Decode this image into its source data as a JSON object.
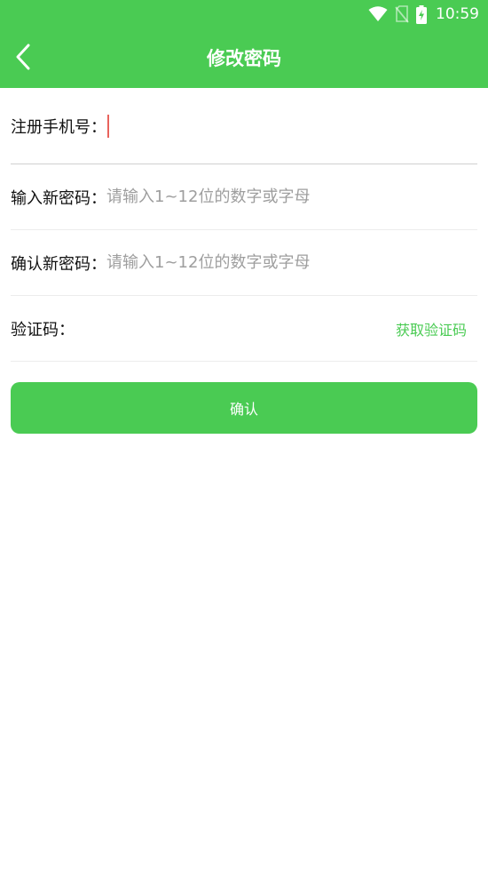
{
  "status_bar": {
    "time": "10:59",
    "icons": [
      "wifi-icon",
      "no-sim-icon",
      "battery-charging-icon"
    ]
  },
  "header": {
    "back_icon": "chevron-left-icon",
    "title": "修改密码"
  },
  "form": {
    "phone": {
      "label": "注册手机号：",
      "value": "",
      "placeholder": ""
    },
    "new_password": {
      "label": "输入新密码：",
      "value": "",
      "placeholder": "请输入1~12位的数字或字母"
    },
    "confirm_password": {
      "label": "确认新密码：",
      "value": "",
      "placeholder": "请输入1~12位的数字或字母"
    },
    "verification_code": {
      "label": "验证码：",
      "value": "",
      "placeholder": "",
      "get_code_label": "获取验证码"
    }
  },
  "confirm_button": {
    "label": "确认"
  },
  "colors": {
    "primary": "#4ACB53",
    "caret": "#E9635C",
    "placeholder": "#9e9e9e"
  }
}
